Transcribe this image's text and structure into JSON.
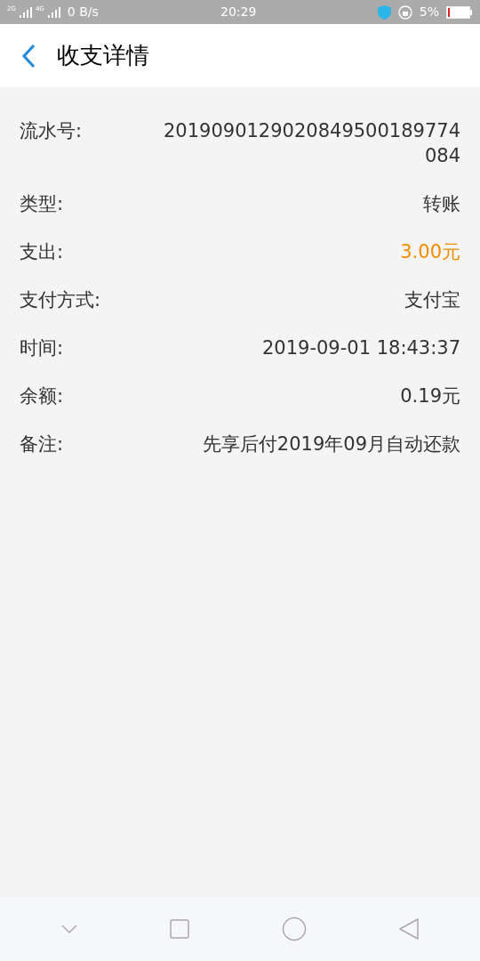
{
  "status_bar": {
    "network_1": "2G",
    "network_2": "4G",
    "speed": "0 B/s",
    "time": "20:29",
    "battery": "5%"
  },
  "header": {
    "title": "收支详情"
  },
  "rows": [
    {
      "label": "流水号:",
      "value": "2019090129020849500189774084",
      "kind": "plain"
    },
    {
      "label": "类型:",
      "value": "转账",
      "kind": "plain"
    },
    {
      "label": "支出:",
      "value": "3.00元",
      "kind": "expense"
    },
    {
      "label": "支付方式:",
      "value": "支付宝",
      "kind": "plain"
    },
    {
      "label": "时间:",
      "value": "2019-09-01 18:43:37",
      "kind": "plain"
    },
    {
      "label": "余额:",
      "value": "0.19元",
      "kind": "plain"
    },
    {
      "label": "备注:",
      "value": "先享后付2019年09月自动还款",
      "kind": "plain"
    }
  ]
}
